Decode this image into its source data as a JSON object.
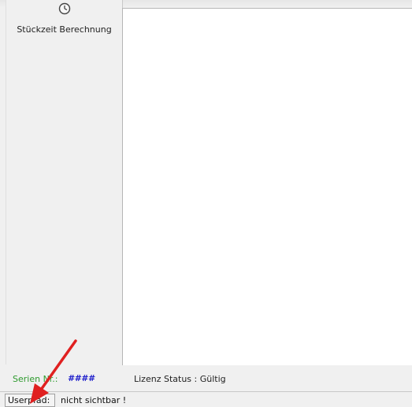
{
  "sidebar": {
    "tool": {
      "icon": "clock-icon",
      "label": "Stückzeit Berechnung"
    }
  },
  "info_bar": {
    "serial_label": "Serien Nr.:",
    "serial_value": "####",
    "license_status": "Lizenz Status : Gültig"
  },
  "status_bar": {
    "label": "Userpfad:",
    "value": "nicht sichtbar !"
  },
  "annotation": {
    "icon": "red-arrow-icon",
    "color": "#e02020"
  },
  "colors": {
    "serial_label": "#2e9a2e",
    "serial_value": "#2222cc",
    "background": "#f0f0f0",
    "content": "#ffffff"
  }
}
